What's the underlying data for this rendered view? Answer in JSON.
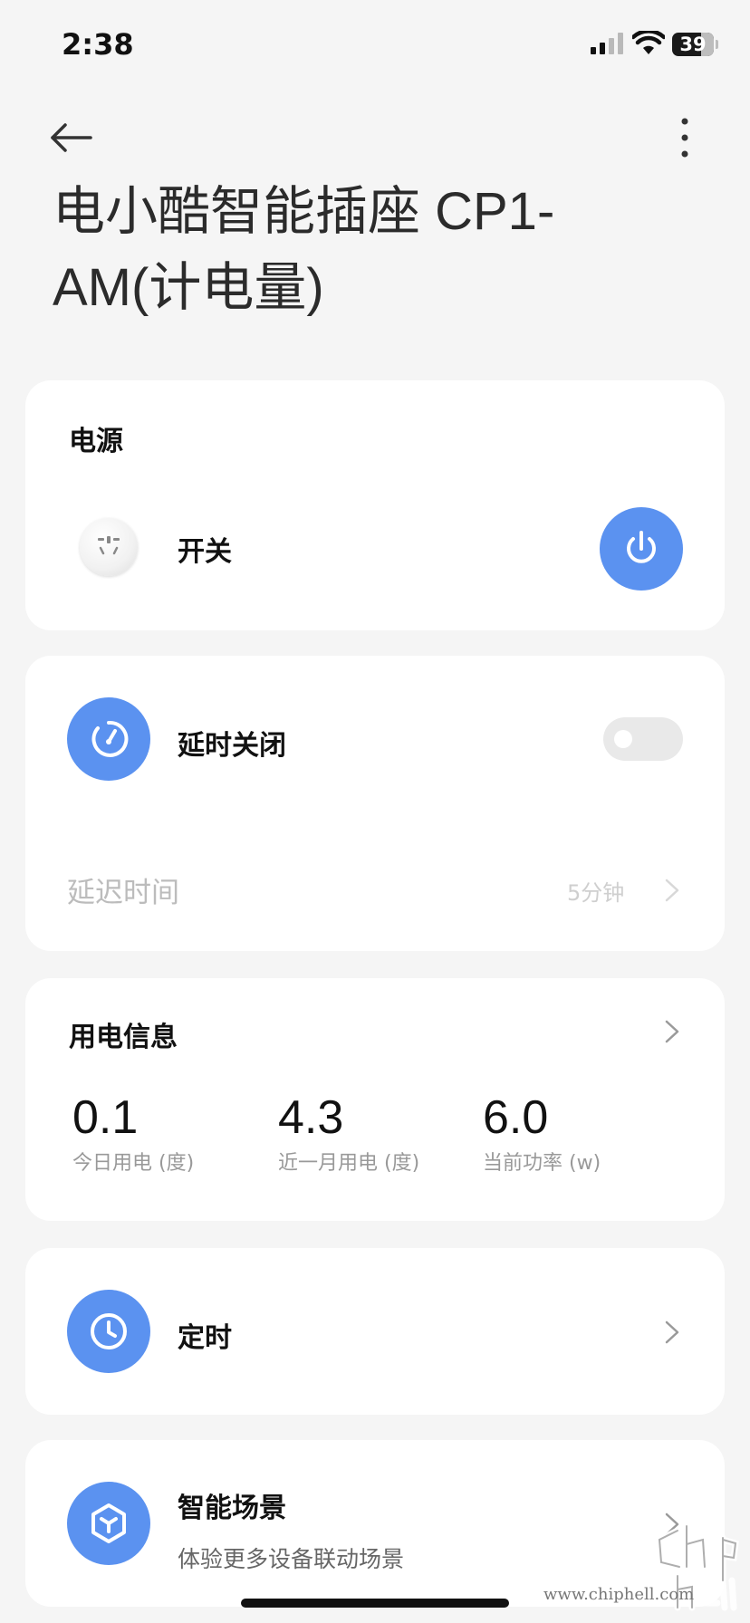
{
  "status": {
    "time": "2:38",
    "battery": "39"
  },
  "header": {
    "title": "电小酷智能插座 CP1-AM(计电量)"
  },
  "power_card": {
    "title": "电源",
    "switch_label": "开关"
  },
  "delay_card": {
    "title": "延时关闭",
    "toggle_on": false,
    "delay_label": "延迟时间",
    "delay_value": "5分钟"
  },
  "energy_card": {
    "title": "用电信息",
    "stats": [
      {
        "value": "0.1",
        "label": "今日用电 (度)"
      },
      {
        "value": "4.3",
        "label": "近一月用电 (度)"
      },
      {
        "value": "6.0",
        "label": "当前功率 (w)"
      }
    ]
  },
  "timer_card": {
    "title": "定时"
  },
  "scene_card": {
    "title": "智能场景",
    "subtitle": "体验更多设备联动场景"
  },
  "watermark": {
    "text": "www.chiphell.com",
    "logo": "chip hell"
  },
  "colors": {
    "accent": "#5b92f0",
    "background": "#f5f5f5",
    "card": "#ffffff"
  }
}
